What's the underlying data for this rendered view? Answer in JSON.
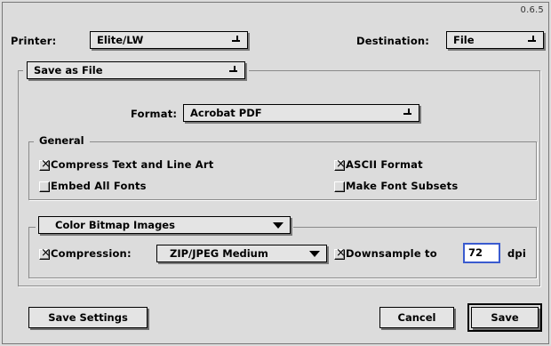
{
  "version": "0.6.5",
  "printer": {
    "label": "Printer:",
    "value": "Elite/LW"
  },
  "destination": {
    "label": "Destination:",
    "value": "File"
  },
  "mode_popup": "Save as File",
  "format": {
    "label": "Format:",
    "value": "Acrobat PDF"
  },
  "general": {
    "title": "General",
    "options": [
      {
        "label": "Compress Text and Line Art",
        "checked": true
      },
      {
        "label": "ASCII Format",
        "checked": true
      },
      {
        "label": "Embed All Fonts",
        "checked": false
      },
      {
        "label": "Make Font Subsets",
        "checked": false
      }
    ]
  },
  "images": {
    "popup": "Color Bitmap Images",
    "compression": {
      "label": "Compression:",
      "checked": true,
      "value": "ZIP/JPEG Medium"
    },
    "downsample": {
      "label": "Downsample to",
      "checked": true,
      "value": "72",
      "unit": "dpi"
    }
  },
  "buttons": {
    "save_settings": "Save Settings",
    "cancel": "Cancel",
    "save": "Save"
  }
}
